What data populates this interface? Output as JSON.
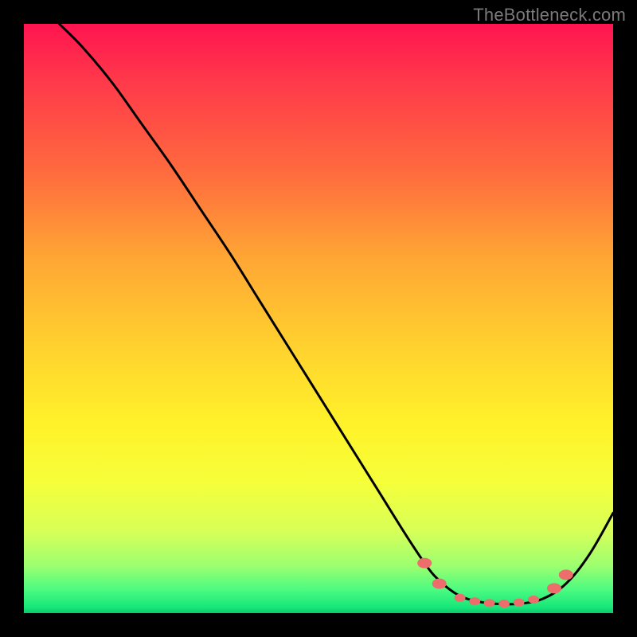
{
  "watermark": "TheBottleneck.com",
  "chart_data": {
    "type": "line",
    "title": "",
    "xlabel": "",
    "ylabel": "",
    "xlim": [
      0,
      100
    ],
    "ylim": [
      0,
      100
    ],
    "grid": false,
    "legend": false,
    "series": [
      {
        "name": "curve",
        "color": "#000000",
        "x": [
          6,
          10,
          15,
          20,
          25,
          30,
          35,
          40,
          45,
          50,
          55,
          60,
          65,
          68,
          70,
          73,
          76,
          80,
          84,
          88,
          92,
          96,
          100
        ],
        "y": [
          100,
          96,
          90,
          83,
          76,
          68.5,
          61,
          53,
          45,
          37,
          29,
          21,
          13,
          8.5,
          6,
          3.5,
          2.2,
          1.6,
          1.6,
          2.4,
          5,
          10,
          17
        ]
      }
    ],
    "markers": {
      "color": "#ed6c6c",
      "points": [
        {
          "x": 68,
          "y": 8.5,
          "r": 9
        },
        {
          "x": 70.5,
          "y": 5,
          "r": 9
        },
        {
          "x": 74,
          "y": 2.6,
          "r": 7
        },
        {
          "x": 76.5,
          "y": 2.0,
          "r": 7
        },
        {
          "x": 79,
          "y": 1.7,
          "r": 7
        },
        {
          "x": 81.5,
          "y": 1.6,
          "r": 7
        },
        {
          "x": 84,
          "y": 1.8,
          "r": 7
        },
        {
          "x": 86.5,
          "y": 2.3,
          "r": 7
        },
        {
          "x": 90,
          "y": 4.2,
          "r": 9
        },
        {
          "x": 92,
          "y": 6.5,
          "r": 9
        }
      ]
    },
    "gradient_stops": [
      {
        "pos": 0.0,
        "color": "#ff1450"
      },
      {
        "pos": 0.1,
        "color": "#ff3a4a"
      },
      {
        "pos": 0.25,
        "color": "#ff6a3e"
      },
      {
        "pos": 0.4,
        "color": "#ffa734"
      },
      {
        "pos": 0.55,
        "color": "#ffd22e"
      },
      {
        "pos": 0.68,
        "color": "#fff22a"
      },
      {
        "pos": 0.78,
        "color": "#f5ff3a"
      },
      {
        "pos": 0.86,
        "color": "#d8ff58"
      },
      {
        "pos": 0.92,
        "color": "#9cff70"
      },
      {
        "pos": 0.96,
        "color": "#4cfb80"
      },
      {
        "pos": 0.99,
        "color": "#17e77a"
      },
      {
        "pos": 1.0,
        "color": "#0cc96a"
      }
    ]
  }
}
